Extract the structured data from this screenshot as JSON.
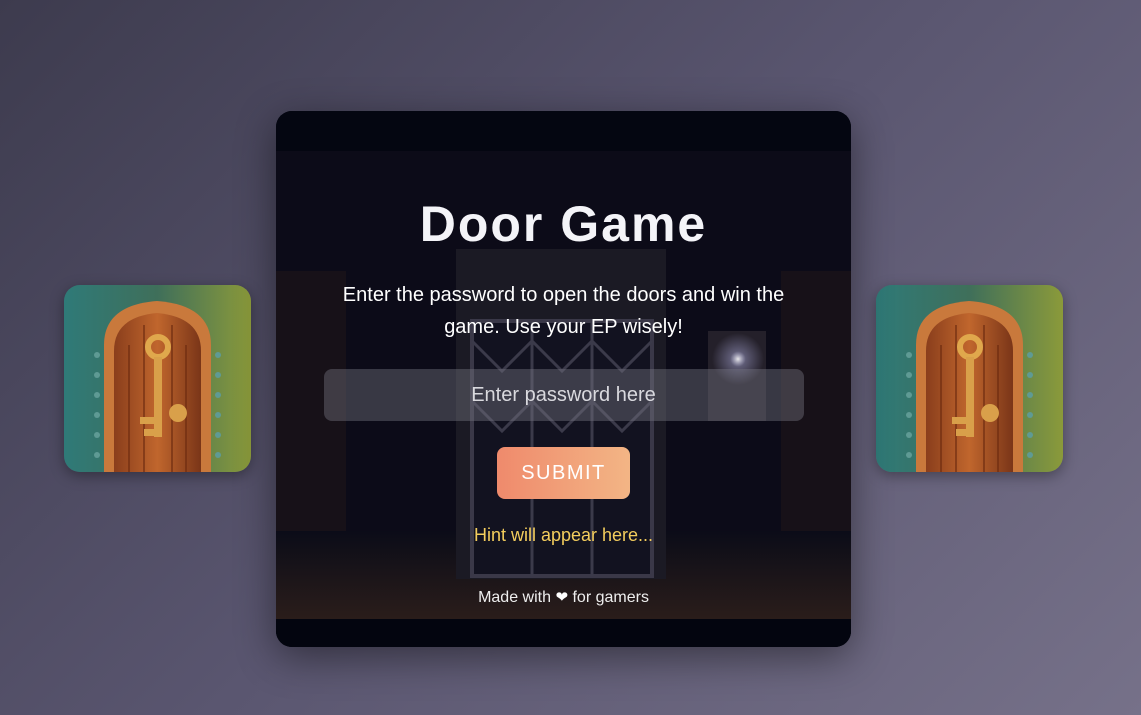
{
  "side_images": {
    "left_icon": "door-with-key-icon",
    "right_icon": "door-with-key-icon"
  },
  "game": {
    "title": "Door Game",
    "description": "Enter the password to open the doors and win the game. Use your EP wisely!",
    "password_placeholder": "Enter password here",
    "password_value": "",
    "submit_label": "SUBMIT",
    "hint_text": "Hint will appear here...",
    "footer_prefix": "Made with",
    "footer_heart": "❤",
    "footer_suffix": "for gamers"
  },
  "colors": {
    "card_background": "#040611",
    "hint": "#f3cd5d",
    "button_start": "#ef8a6c",
    "button_end": "#f3b585"
  }
}
